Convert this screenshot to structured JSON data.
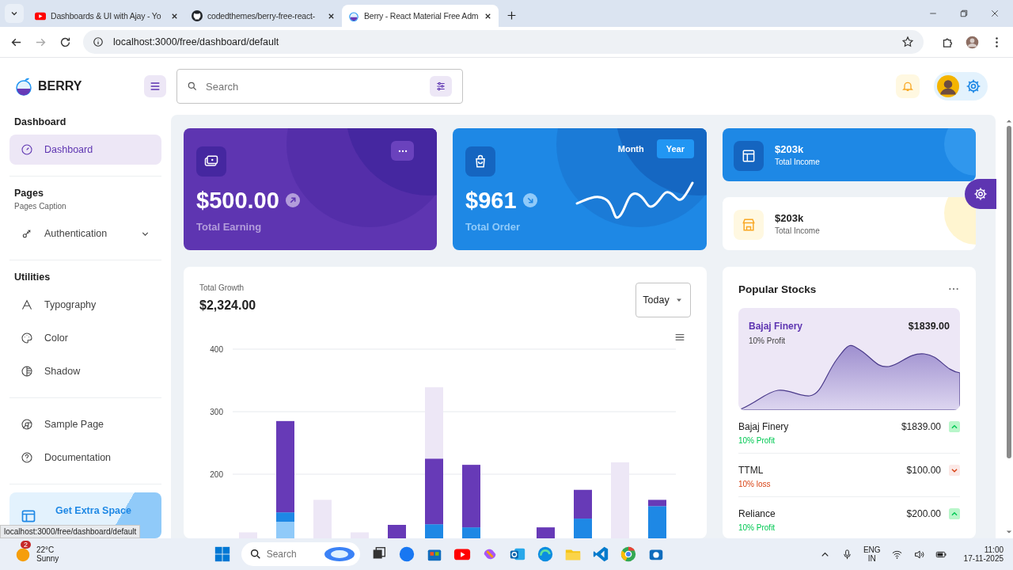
{
  "browser": {
    "tabs": [
      {
        "title": "Dashboards & UI with Ajay - Yo",
        "selected": false
      },
      {
        "title": "codedthemes/berry-free-react-",
        "selected": false
      },
      {
        "title": "Berry - React Material Free Adm",
        "selected": true
      }
    ],
    "address": "localhost:3000/free/dashboard/default"
  },
  "header": {
    "brand": "BERRY",
    "search": {
      "placeholder": "Search"
    }
  },
  "sidebar": {
    "sections": [
      {
        "title": "Dashboard",
        "items": [
          {
            "label": "Dashboard",
            "selected": true
          }
        ]
      },
      {
        "title": "Pages",
        "caption": "Pages Caption",
        "items": [
          {
            "label": "Authentication",
            "selected": false,
            "expanded": false
          }
        ]
      },
      {
        "title": "Utilities",
        "items": [
          {
            "label": "Typography",
            "selected": false
          },
          {
            "label": "Color",
            "selected": false
          },
          {
            "label": "Shadow",
            "selected": false
          }
        ]
      },
      {
        "items": [
          {
            "label": "Sample Page",
            "selected": false
          },
          {
            "label": "Documentation",
            "selected": false
          }
        ]
      }
    ],
    "promo": {
      "title": "Get Extra Space"
    }
  },
  "earning": {
    "value": "$500.00",
    "label": "Total Earning"
  },
  "order": {
    "toggle": [
      {
        "label": "Month",
        "selected": false
      },
      {
        "label": "Year",
        "selected": true
      }
    ],
    "value": "$961",
    "label": "Total Order"
  },
  "income": [
    {
      "kind": "dark",
      "value": "$203k",
      "label": "Total Income"
    },
    {
      "kind": "light",
      "value": "$203k",
      "label": "Total Income"
    }
  ],
  "growth": {
    "caption": "Total Growth",
    "value": "$2,324.00",
    "period": "Today",
    "chart_data": {
      "type": "bar",
      "stacked": true,
      "ylim": [
        0,
        400
      ],
      "yticks": [
        200,
        300,
        400
      ],
      "series": [
        {
          "color": "#90caf9",
          "values": [
            null,
            124,
            null,
            null,
            null,
            null,
            null,
            null,
            null,
            null,
            null,
            null
          ]
        },
        {
          "color": "#1e88e5",
          "values": [
            null,
            15,
            null,
            null,
            null,
            120,
            115,
            null,
            null,
            129,
            null,
            149
          ]
        },
        {
          "color": "#673ab7",
          "values": [
            null,
            146,
            null,
            null,
            119,
            105,
            100,
            null,
            115,
            46,
            null,
            10
          ]
        },
        {
          "color": "#ede7f6",
          "values": [
            107,
            null,
            159,
            107,
            null,
            114,
            null,
            null,
            null,
            null,
            219,
            null
          ]
        }
      ]
    }
  },
  "stocks": {
    "title": "Popular Stocks",
    "featured": {
      "name": "Bajaj Finery",
      "price": "$1839.00",
      "change": "10% Profit"
    },
    "rows": [
      {
        "name": "Bajaj Finery",
        "price": "$1839.00",
        "change": "10% Profit",
        "kind": "up"
      },
      {
        "name": "TTML",
        "price": "$100.00",
        "change": "10% loss",
        "kind": "down"
      },
      {
        "name": "Reliance",
        "price": "$200.00",
        "change": "10% Profit",
        "kind": "up"
      }
    ]
  },
  "status_url": "localhost:3000/free/dashboard/default",
  "taskbar": {
    "weather": {
      "badge": "2",
      "temperature": "22°C",
      "condition": "Sunny"
    },
    "search": {
      "placeholder": "Search"
    },
    "language": {
      "code": "ENG",
      "region": "IN"
    },
    "time": "11:00",
    "date": "17-11-2025"
  }
}
